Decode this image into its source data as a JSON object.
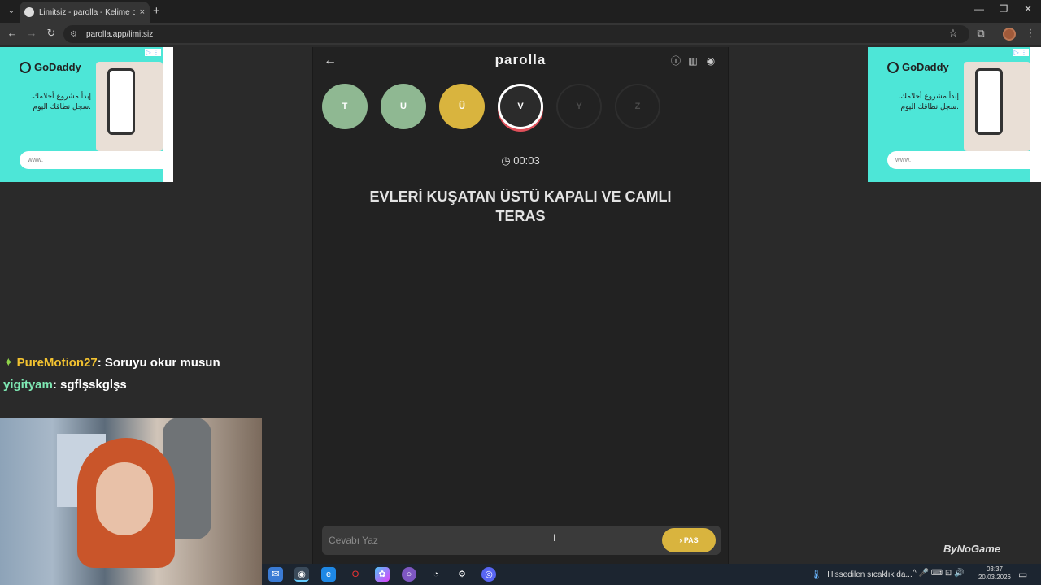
{
  "browser": {
    "tab_title": "Limitsiz - parolla - Kelime oyunu",
    "tab_close": "×",
    "new_tab": "+",
    "tab_dropdown": "⌄",
    "url": "parolla.app/limitsiz",
    "window": {
      "minimize": "—",
      "restore": "❐",
      "close": "✕"
    },
    "nav": {
      "back": "←",
      "forward": "→",
      "reload": "↻"
    },
    "toolbar_icons": {
      "star": "☆",
      "extensions": "⧉",
      "menu": "⋮"
    }
  },
  "ads": {
    "brand": "GoDaddy",
    "text": "إبدأ مشروع أحلامك. سجل نطاقك اليوم.",
    "url_placeholder": "www.",
    "adchoices": "▷ ⋮"
  },
  "game": {
    "back": "←",
    "title": "parolla",
    "icons": {
      "info": "ⓘ",
      "stats": "▥",
      "profile": "◉"
    },
    "letters": [
      {
        "letter": "T",
        "state": "correct",
        "color": "#8fb892"
      },
      {
        "letter": "U",
        "state": "correct",
        "color": "#8fb892"
      },
      {
        "letter": "Ü",
        "state": "passed",
        "color": "#d9b43e"
      },
      {
        "letter": "V",
        "state": "active",
        "color": "#2b2b2b"
      },
      {
        "letter": "Y",
        "state": "pending",
        "color": "#222222"
      },
      {
        "letter": "Z",
        "state": "pending",
        "color": "#222222"
      }
    ],
    "timer_icon": "◷",
    "timer": "00:03",
    "question": "EVLERİ KUŞATAN ÜSTÜ KAPALI VE CAMLI TERAS",
    "answer_placeholder": "Cevabı Yaz",
    "pass_label": "› PAS"
  },
  "chat": [
    {
      "user": "PureMotion27",
      "message": ": Soruyu okur musun",
      "badge": "✦"
    },
    {
      "user": "yigityam",
      "message": ": sgflşskglşs"
    }
  ],
  "watermark": "ByNoGame",
  "taskbar": {
    "weather": "Hissedilen sıcaklık da...",
    "weather_icon": "🌡",
    "tray": "^  🎤  ⌨  ⊡  🔊",
    "time": "03:37",
    "date": "20.03.2026",
    "notif": "▭"
  }
}
